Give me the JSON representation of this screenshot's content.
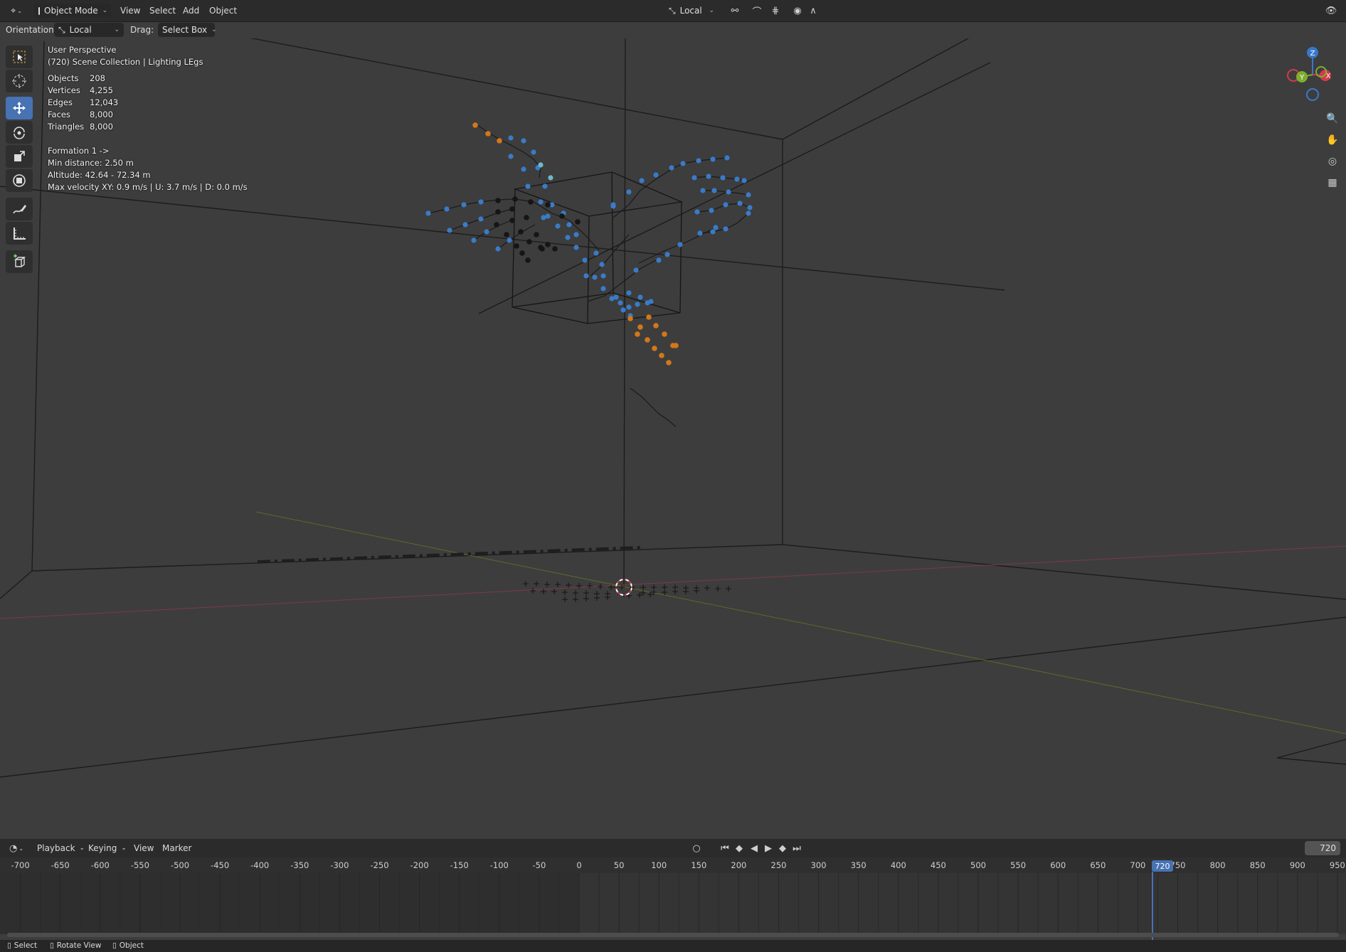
{
  "header": {
    "editor_icon": "3d-viewport-icon",
    "mode": "Object Mode",
    "menus": [
      "View",
      "Select",
      "Add",
      "Object"
    ],
    "pivot": "Local",
    "accent": "#4772b3"
  },
  "tool_settings": {
    "orientation_label": "Orientation:",
    "orientation_value": "Local",
    "drag_label": "Drag:",
    "drag_value": "Select Box"
  },
  "toolbar": {
    "tools": [
      "select-box",
      "cursor",
      "move",
      "rotate",
      "scale",
      "transform",
      "annotate",
      "measure",
      "add-cube"
    ],
    "active_tool": "move"
  },
  "viewport_overlay": {
    "view_name": "User Perspective",
    "collection": "(720) Scene Collection | Lighting LEgs",
    "stats": [
      {
        "label": "Objects",
        "value": "208"
      },
      {
        "label": "Vertices",
        "value": "4,255"
      },
      {
        "label": "Edges",
        "value": "12,043"
      },
      {
        "label": "Faces",
        "value": "8,000"
      },
      {
        "label": "Triangles",
        "value": "8,000"
      }
    ],
    "formation": "Formation 1 ->",
    "min_distance": "Min distance: 2.50 m",
    "altitude": "Altitude: 42.64 - 72.34 m",
    "max_velocity": "Max velocity XY: 0.9 m/s | U: 3.7 m/s | D: 0.0 m/s"
  },
  "gizmo": {
    "z_label": "Z",
    "y_label": "Y",
    "x_label": "X",
    "x_color": "#d33a4a",
    "y_color": "#7fae2f",
    "z_color": "#3a78c9"
  },
  "timeline": {
    "menus": [
      "Playback",
      "Keying",
      "View",
      "Marker"
    ],
    "current_frame": "720",
    "ticks": [
      "-700",
      "-650",
      "-600",
      "-550",
      "-500",
      "-450",
      "-400",
      "-350",
      "-300",
      "-250",
      "-200",
      "-150",
      "-100",
      "-50",
      "0",
      "50",
      "100",
      "150",
      "200",
      "250",
      "300",
      "350",
      "400",
      "450",
      "500",
      "550",
      "600",
      "650",
      "700",
      "750",
      "800",
      "850",
      "900",
      "950"
    ]
  },
  "statusbar": {
    "items": [
      "Select",
      "Rotate View",
      "Object"
    ]
  }
}
